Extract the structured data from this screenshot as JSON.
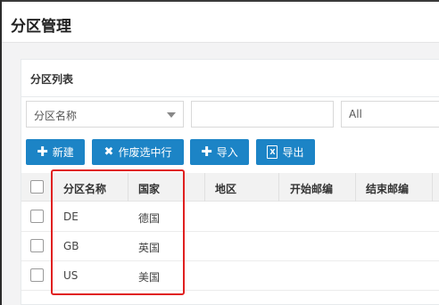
{
  "dialog": {
    "title": "分区管理"
  },
  "panel": {
    "title": "分区列表"
  },
  "filters": {
    "name_select": "分区名称",
    "keyword_value": "",
    "status_select": "All"
  },
  "toolbar": {
    "add_label": "新建",
    "void_label": "作废选中行",
    "import_label": "导入",
    "export_label": "导出"
  },
  "table": {
    "columns": [
      "分区名称",
      "国家",
      "地区",
      "开始邮编",
      "结束邮编"
    ],
    "rows": [
      {
        "code": "DE",
        "country": "德国",
        "region": "",
        "start_zip": "",
        "end_zip": ""
      },
      {
        "code": "GB",
        "country": "英国",
        "region": "",
        "start_zip": "",
        "end_zip": ""
      },
      {
        "code": "US",
        "country": "美国",
        "region": "",
        "start_zip": "",
        "end_zip": ""
      }
    ]
  },
  "colors": {
    "primary": "#1c84c6",
    "highlight": "#e02020"
  },
  "icons": {
    "add": "plus-icon",
    "void": "x-icon",
    "import": "plus-icon",
    "export": "excel-file-icon"
  }
}
